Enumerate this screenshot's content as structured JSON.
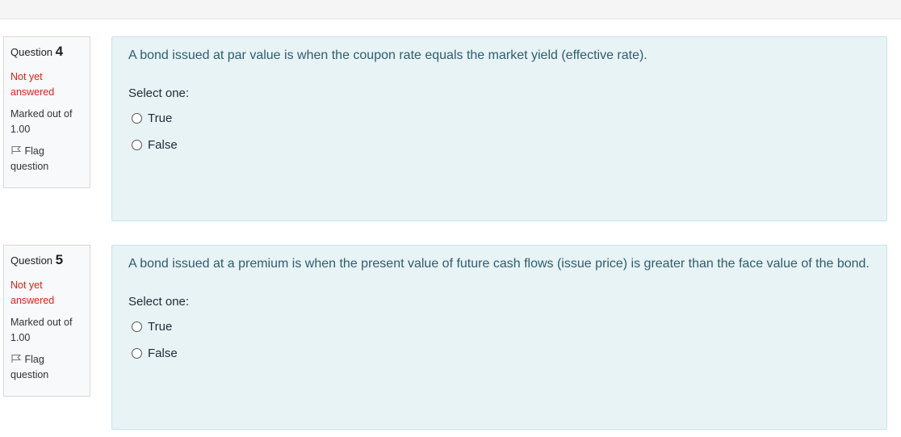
{
  "questions": [
    {
      "label": "Question",
      "number": "4",
      "state": [
        "Not yet",
        "answered"
      ],
      "grade": [
        "Marked out of",
        "1.00"
      ],
      "flag": [
        "Flag",
        "question"
      ],
      "text": "A bond issued at par value is when the coupon rate equals the market yield (effective rate).",
      "prompt": "Select one:",
      "options": [
        "True",
        "False"
      ]
    },
    {
      "label": "Question",
      "number": "5",
      "state": [
        "Not yet",
        "answered"
      ],
      "grade": [
        "Marked out of",
        "1.00"
      ],
      "flag": [
        "Flag",
        "question"
      ],
      "text": "A bond issued at a premium is when the present value of future cash flows (issue price) is greater than the face value of the bond.",
      "prompt": "Select one:",
      "options": [
        "True",
        "False"
      ]
    }
  ],
  "colors": {
    "state": "#e0211c",
    "content_bg": "#e7f3f5",
    "question_text": "#2f5d6e"
  }
}
